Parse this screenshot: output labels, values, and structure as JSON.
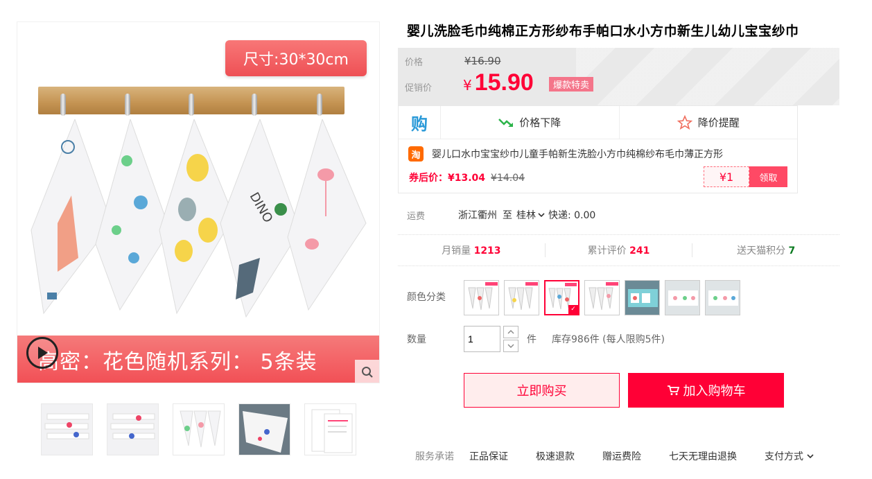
{
  "product": {
    "title": "婴儿洗脸毛巾纯棉正方形纱布手帕口水小方巾新生儿幼儿宝宝纱巾"
  },
  "gallery": {
    "size_badge": "尺寸:30*30cm",
    "banner_text": "高密：花色随机系列： 5条装",
    "play_icon": "play-icon",
    "zoom_icon": "search-icon",
    "thumbnail_count": 5
  },
  "price": {
    "orig_label": "价格",
    "orig_currency": "¥",
    "orig_value": "16.90",
    "promo_label": "促销价",
    "promo_currency": "¥",
    "promo_value": "15.90",
    "hot_tag": "爆款特卖"
  },
  "coupon": {
    "buy_logo": "购",
    "price_drop": "价格下降",
    "price_alert": "降价提醒",
    "tao_logo": "淘",
    "item_title": "婴儿口水巾宝宝纱巾儿童手帕新生洗脸小方巾纯棉纱布毛巾薄正方形",
    "after_label": "券后价：",
    "after_value": "¥13.04",
    "after_strike": "¥14.04",
    "coupon_amount": "¥1",
    "get_label": "领取"
  },
  "shipping": {
    "label": "运费",
    "from": "浙江衢州",
    "to_word": "至",
    "dest": "桂林",
    "fee": "快递: 0.00"
  },
  "stats": {
    "monthly_label": "月销量",
    "monthly_value": "1213",
    "reviews_label": "累计评价",
    "reviews_value": "241",
    "points_label": "送天猫积分",
    "points_value": "7"
  },
  "options": {
    "color_label": "颜色分类",
    "swatch_count": 7,
    "selected_index": 2,
    "qty_label": "数量",
    "qty_value": "1",
    "unit": "件",
    "stock": "库存986件  (每人限购5件)"
  },
  "actions": {
    "buy_now": "立即购买",
    "add_cart": "加入购物车"
  },
  "service": {
    "label": "服务承诺",
    "items": [
      "正品保证",
      "极速退款",
      "赠运费险",
      "七天无理由退换"
    ],
    "payment": "支付方式"
  },
  "colors": {
    "accent": "#ff0036",
    "hot_tag": "#f4758a",
    "banner": "#f24f55"
  }
}
